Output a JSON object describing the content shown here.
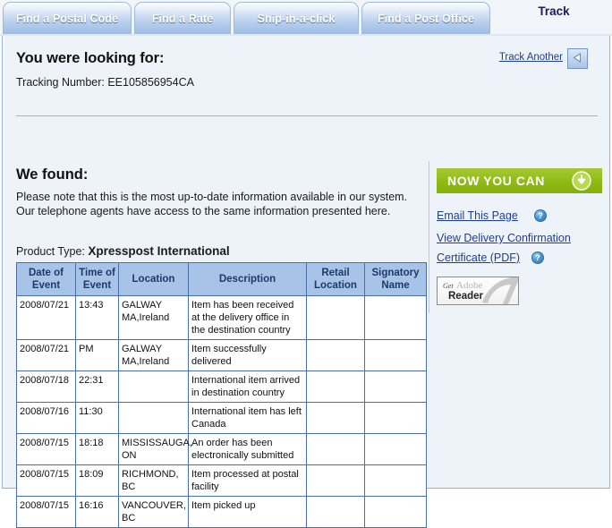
{
  "tabs": [
    {
      "label": "Find a Postal Code"
    },
    {
      "label": "Find a Rate"
    },
    {
      "label": "Ship-in-a-click"
    },
    {
      "label": "Find a Post Office"
    }
  ],
  "section_title": "Track",
  "looking_for": {
    "heading": "You were looking for:",
    "tracking_label": "Tracking Number:",
    "tracking_number": "EE105856954CA",
    "tracking_line": "Tracking Number: EE105856954CA",
    "track_another_label": "Track Another",
    "back_icon": "left-triangle-icon"
  },
  "found": {
    "heading": "We found:",
    "note": "Please note that this is the most up-to-date information available in our system. Our telephone agents have access to the same information presented here.",
    "product_type_label": "Product Type:",
    "product_type_value": "Xpresspost International"
  },
  "sidebar": {
    "banner_title": "NOW YOU CAN",
    "banner_icon": "download-circle-icon",
    "links": [
      {
        "label": "Email This Page",
        "help_icon": "help-question-icon"
      },
      {
        "label": "View Delivery Confirmation",
        "help_icon": ""
      },
      {
        "label": "Certificate (PDF)",
        "help_icon": "help-question-icon"
      }
    ],
    "adobe": {
      "get": "Get",
      "adobe": "Adobe",
      "reader": "Reader"
    }
  },
  "table": {
    "headers": [
      "Date of Event",
      "Time of Event",
      "Location",
      "Description",
      "Retail Location",
      "Signatory Name"
    ],
    "rows": [
      {
        "date": "2008/07/21",
        "time": "13:43",
        "location": "GALWAY MA,Ireland",
        "description": "Item has been received at the delivery office in the destination country",
        "retail": "",
        "signatory": ""
      },
      {
        "date": "2008/07/21",
        "time": "PM",
        "location": "GALWAY MA,Ireland",
        "description": "Item successfully delivered",
        "retail": "",
        "signatory": ""
      },
      {
        "date": "2008/07/18",
        "time": "22:31",
        "location": "",
        "description": "International item arrived in destination country",
        "retail": "",
        "signatory": ""
      },
      {
        "date": "2008/07/16",
        "time": "11:30",
        "location": "",
        "description": "International item has left Canada",
        "retail": "",
        "signatory": ""
      },
      {
        "date": "2008/07/15",
        "time": "18:18",
        "location": "MISSISSAUGA, ON",
        "description": "An order has been electronically submitted",
        "retail": "",
        "signatory": ""
      },
      {
        "date": "2008/07/15",
        "time": "18:09",
        "location": "RICHMOND, BC",
        "description": "Item processed at postal facility",
        "retail": "",
        "signatory": ""
      },
      {
        "date": "2008/07/15",
        "time": "16:16",
        "location": "VANCOUVER, BC",
        "description": "Item picked up",
        "retail": "",
        "signatory": ""
      }
    ]
  },
  "colors": {
    "tab_blue": "#9dbce5",
    "link_blue": "#1a3f9b",
    "banner_green": "#8fba15",
    "header_blue": "#a8c3e8"
  }
}
